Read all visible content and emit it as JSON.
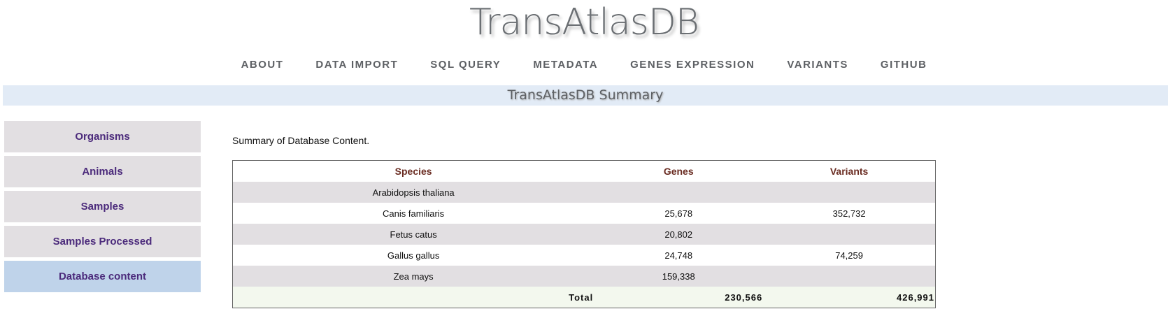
{
  "header": {
    "title": "TransAtlasDB"
  },
  "nav": [
    "ABOUT",
    "DATA IMPORT",
    "SQL QUERY",
    "METADATA",
    "GENES EXPRESSION",
    "VARIANTS",
    "GITHUB"
  ],
  "banner": "TransAtlasDB Summary",
  "sidebar": [
    "Organisms",
    "Animals",
    "Samples",
    "Samples Processed",
    "Database content"
  ],
  "intro": "Summary of Database Content.",
  "table": {
    "headers": [
      "Species",
      "Genes",
      "Variants"
    ],
    "rows": [
      [
        "Arabidopsis thaliana",
        "",
        ""
      ],
      [
        "Canis familiaris",
        "25,678",
        "352,732"
      ],
      [
        "Fetus catus",
        "20,802",
        ""
      ],
      [
        "Gallus gallus",
        "24,748",
        "74,259"
      ],
      [
        "Zea mays",
        "159,338",
        ""
      ]
    ],
    "total": {
      "label": "Total",
      "genes": "230,566",
      "variants": "426,991"
    }
  }
}
